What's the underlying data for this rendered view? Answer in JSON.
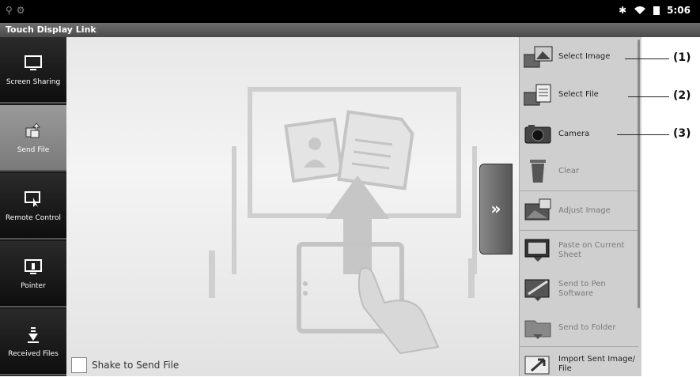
{
  "status": {
    "time": "5:06"
  },
  "app_title": "Touch Display Link",
  "nav": [
    {
      "label": "Screen Sharing"
    },
    {
      "label": "Send File"
    },
    {
      "label": "Remote Control"
    },
    {
      "label": "Pointer"
    },
    {
      "label": "Received Files"
    }
  ],
  "shake_label": "Shake to Send File",
  "toggle_label": "»",
  "actions": [
    {
      "label": "Select Image"
    },
    {
      "label": "Select File"
    },
    {
      "label": "Camera"
    },
    {
      "label": "Clear"
    },
    {
      "label": "Adjust Image"
    },
    {
      "label": "Paste on Current Sheet"
    },
    {
      "label": "Send to Pen Software"
    },
    {
      "label": "Send to Folder"
    },
    {
      "label": "Import Sent Image/ File"
    }
  ],
  "callouts": [
    "(1)",
    "(2)",
    "(3)"
  ]
}
